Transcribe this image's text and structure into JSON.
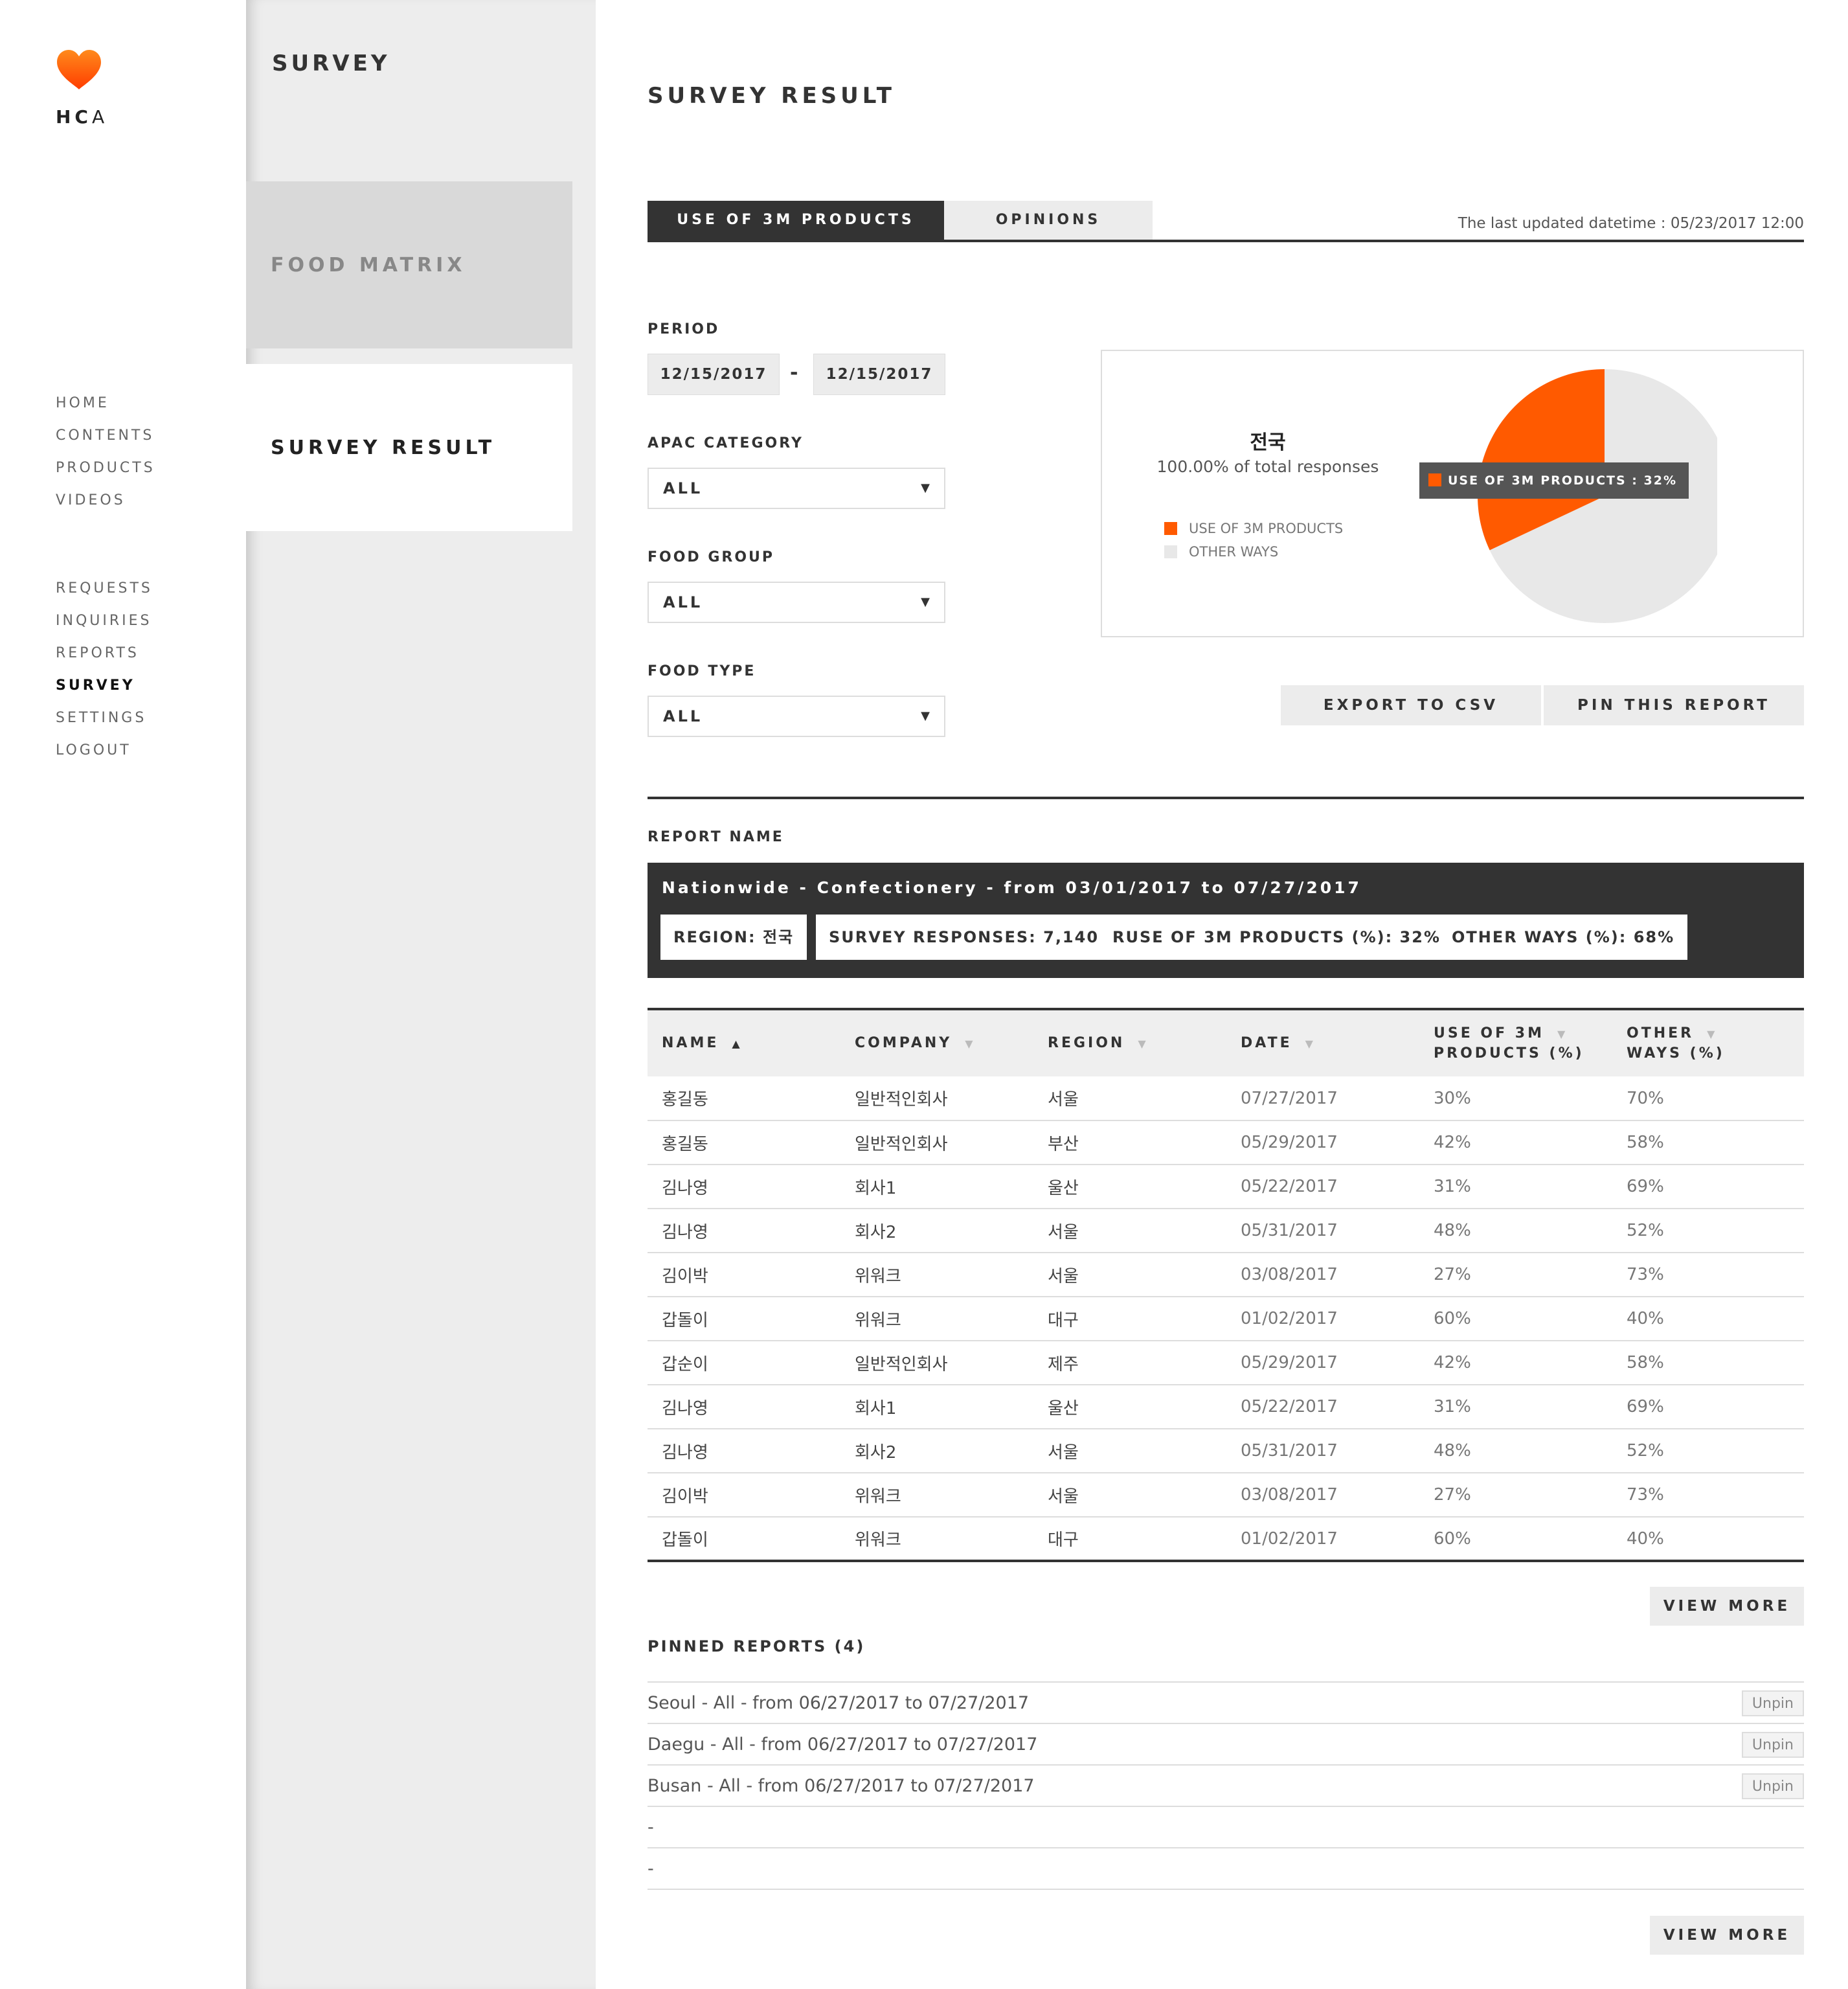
{
  "brand": {
    "logo_text_bold": "HC",
    "logo_text_light": "A",
    "accent": "#ff5a00"
  },
  "nav": {
    "group1": [
      "HOME",
      "CONTENTS",
      "PRODUCTS",
      "VIDEOS"
    ],
    "group2": [
      "REQUESTS",
      "INQUIRIES",
      "REPORTS",
      "SURVEY",
      "SETTINGS",
      "LOGOUT"
    ],
    "active": "SURVEY"
  },
  "submenu": {
    "title": "SURVEY",
    "items": [
      "FOOD MATRIX",
      "SURVEY RESULT"
    ],
    "active": "SURVEY RESULT"
  },
  "main": {
    "title": "SURVEY RESULT",
    "tabs": [
      "USE OF 3M PRODUCTS",
      "OPINIONS"
    ],
    "updated": "The last updated datetime : 05/23/2017 12:00"
  },
  "filters": {
    "period_label": "PERIOD",
    "date_from": "12/15/2017",
    "date_sep": "-",
    "date_to": "12/15/2017",
    "apac_label": "APAC CATEGORY",
    "apac_value": "ALL",
    "group_label": "FOOD GROUP",
    "group_value": "ALL",
    "type_label": "FOOD TYPE",
    "type_value": "ALL",
    "caret": "▼"
  },
  "chart_data": {
    "type": "pie",
    "title": "전국",
    "subtitle": "100.00% of total responses",
    "labels": [
      "USE OF 3M PRODUCTS",
      "OTHER WAYS"
    ],
    "values": [
      32,
      68
    ],
    "colors": [
      "#ff5a00",
      "#e8e8e8"
    ],
    "tooltip": "USE OF 3M PRODUCTS : 32%",
    "legend": "left"
  },
  "actions": {
    "export": "EXPORT TO CSV",
    "pin": "PIN THIS REPORT"
  },
  "report": {
    "label": "REPORT NAME",
    "title": "Nationwide - Confectionery - from 03/01/2017 to 07/27/2017",
    "chips": {
      "region": "REGION: 전국",
      "responses": "SURVEY RESPONSES: 7,140",
      "use": "RUSE OF 3M PRODUCTS (%): 32%",
      "other": "OTHER WAYS (%): 68%"
    }
  },
  "table": {
    "headers": {
      "name": "NAME",
      "company": "COMPANY",
      "region": "REGION",
      "date": "DATE",
      "use_1": "USE OF 3M",
      "use_2": "PRODUCTS (%)",
      "other_1": "OTHER",
      "other_2": "WAYS (%)"
    },
    "sort_on": "▲",
    "sort_off": "▼",
    "rows": [
      [
        "홍길동",
        "일반적인회사",
        "서울",
        "07/27/2017",
        "30%",
        "70%"
      ],
      [
        "홍길동",
        "일반적인회사",
        "부산",
        "05/29/2017",
        "42%",
        "58%"
      ],
      [
        "김나영",
        "회사1",
        "울산",
        "05/22/2017",
        "31%",
        "69%"
      ],
      [
        "김나영",
        "회사2",
        "서울",
        "05/31/2017",
        "48%",
        "52%"
      ],
      [
        "김이박",
        "위워크",
        "서울",
        "03/08/2017",
        "27%",
        "73%"
      ],
      [
        "갑돌이",
        "위워크",
        "대구",
        "01/02/2017",
        "60%",
        "40%"
      ],
      [
        "갑순이",
        "일반적인회사",
        "제주",
        "05/29/2017",
        "42%",
        "58%"
      ],
      [
        "김나영",
        "회사1",
        "울산",
        "05/22/2017",
        "31%",
        "69%"
      ],
      [
        "김나영",
        "회사2",
        "서울",
        "05/31/2017",
        "48%",
        "52%"
      ],
      [
        "김이박",
        "위워크",
        "서울",
        "03/08/2017",
        "27%",
        "73%"
      ],
      [
        "갑돌이",
        "위워크",
        "대구",
        "01/02/2017",
        "60%",
        "40%"
      ]
    ]
  },
  "view_more": "VIEW MORE",
  "pinned": {
    "label": "PINNED REPORTS (4)",
    "unpin": "Unpin",
    "items": [
      "Seoul - All - from 06/27/2017 to 07/27/2017",
      "Daegu - All - from 06/27/2017 to 07/27/2017",
      "Busan - All - from 06/27/2017 to 07/27/2017",
      "-",
      "-"
    ]
  }
}
